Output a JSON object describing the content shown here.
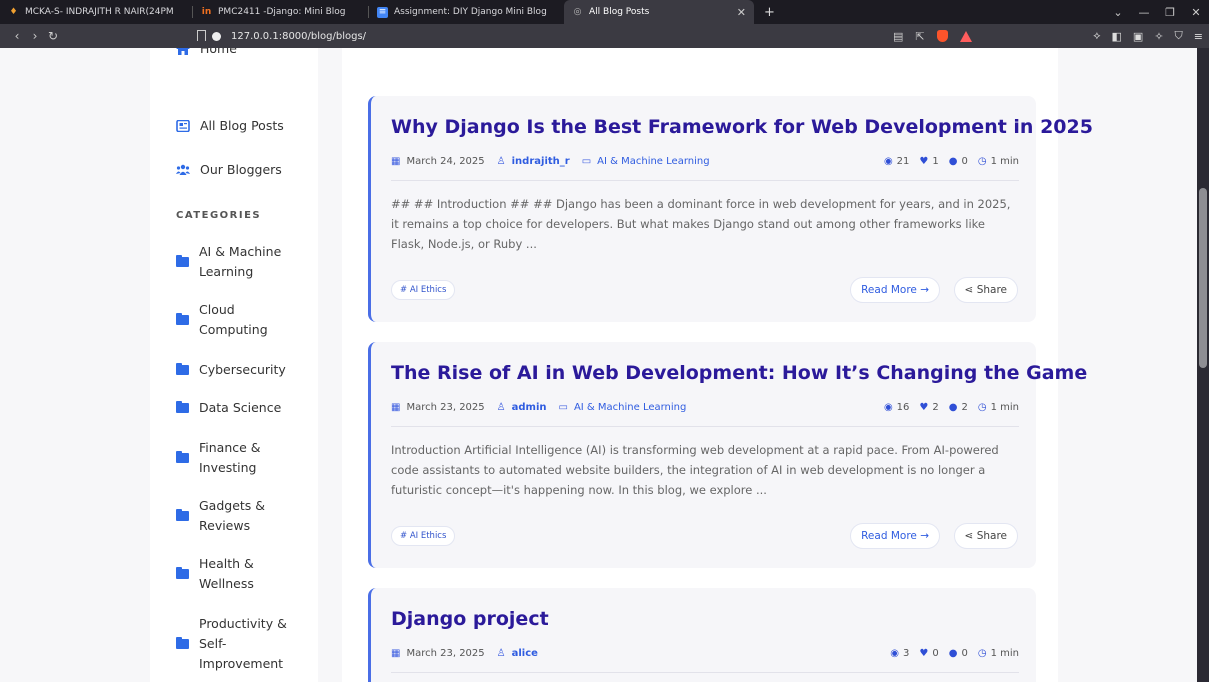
{
  "browser": {
    "tabs": [
      {
        "label": "MCKA-S- INDRAJITH R NAIR(24PM",
        "icon": "orange-person-icon",
        "color": "#f0a030"
      },
      {
        "label": "PMC2411 -Django: Mini Blog",
        "icon": "linways-icon",
        "color": "#f07020"
      },
      {
        "label": "Assignment: DIY Django Mini Blog",
        "icon": "docs-icon",
        "color": "#4285f4"
      },
      {
        "label": "All Blog Posts",
        "icon": "globe-icon",
        "color": "#aaaaaa"
      }
    ],
    "url": "127.0.0.1:8000/blog/blogs/"
  },
  "sidebar": {
    "nav": [
      {
        "label": "Home",
        "icon": "home-icon"
      },
      {
        "label": "All Blog Posts",
        "icon": "newspaper-icon"
      },
      {
        "label": "Our Bloggers",
        "icon": "users-icon"
      }
    ],
    "categories_heading": "CATEGORIES",
    "categories": [
      {
        "line1": "AI & Machine",
        "line2": "Learning",
        "line3": ""
      },
      {
        "line1": "Cloud",
        "line2": "Computing",
        "line3": ""
      },
      {
        "line1": "Cybersecurity",
        "line2": "",
        "line3": ""
      },
      {
        "line1": "Data Science",
        "line2": "",
        "line3": ""
      },
      {
        "line1": "Finance &",
        "line2": "Investing",
        "line3": ""
      },
      {
        "line1": "Gadgets &",
        "line2": "Reviews",
        "line3": ""
      },
      {
        "line1": "Health &",
        "line2": "Wellness",
        "line3": ""
      },
      {
        "line1": "Productivity &",
        "line2": "Self-",
        "line3": "Improvement"
      }
    ]
  },
  "posts": [
    {
      "title": "Why Django Is the Best Framework for Web Development in 2025",
      "date": "March 24, 2025",
      "author": "indrajith_r",
      "category": "AI & Machine Learning",
      "views": "21",
      "likes": "1",
      "comments": "0",
      "read_time": "1 min",
      "excerpt": "## ## Introduction ## ## Django has been a dominant force in web development for years, and in 2025, it remains a top choice for developers. But what makes Django stand out among other frameworks like Flask, Node.js, or Ruby ...",
      "tag": "# AI Ethics",
      "read_more": "Read More →",
      "share": "Share"
    },
    {
      "title": "The Rise of AI in Web Development: How It’s Changing the Game",
      "date": "March 23, 2025",
      "author": "admin",
      "category": "AI & Machine Learning",
      "views": "16",
      "likes": "2",
      "comments": "2",
      "read_time": "1 min",
      "excerpt": "Introduction Artificial Intelligence (AI) is transforming web development at a rapid pace. From AI-powered code assistants to automated website builders, the integration of AI in web development is no longer a futuristic concept—it's happening now. In this blog, we explore ...",
      "tag": "# AI Ethics",
      "read_more": "Read More →",
      "share": "Share"
    },
    {
      "title": "Django project",
      "date": "March 23, 2025",
      "author": "alice",
      "category": "",
      "views": "3",
      "likes": "0",
      "comments": "0",
      "read_time": "1 min"
    }
  ]
}
